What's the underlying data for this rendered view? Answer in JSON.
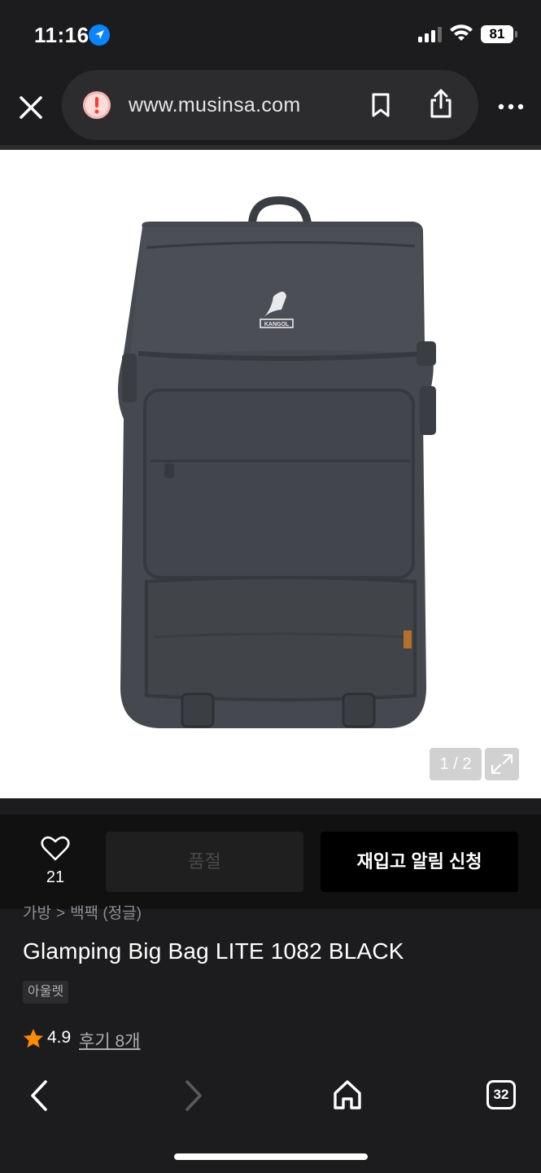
{
  "status_bar": {
    "time": "11:16",
    "battery": "81"
  },
  "browser": {
    "url": "www.musinsa.com"
  },
  "image_viewer": {
    "page_indicator": "1 / 2",
    "product_logo_text": "KANGOL"
  },
  "action_bar": {
    "like_count": "21",
    "soldout_label": "품절",
    "restock_label": "재입고 알림 신청"
  },
  "product": {
    "breadcrumb": [
      "가방",
      "백팩 (정글)"
    ],
    "breadcrumb_separator": ">",
    "title": "Glamping Big Bag LITE 1082 BLACK",
    "tag": "아울렛",
    "rating": "4.9",
    "review_link": "후기 8개"
  },
  "bottom_toolbar": {
    "tab_count": "32"
  },
  "colors": {
    "background": "#1c1c1e",
    "star": "#ff8a00",
    "warning": "#ff3b30"
  }
}
